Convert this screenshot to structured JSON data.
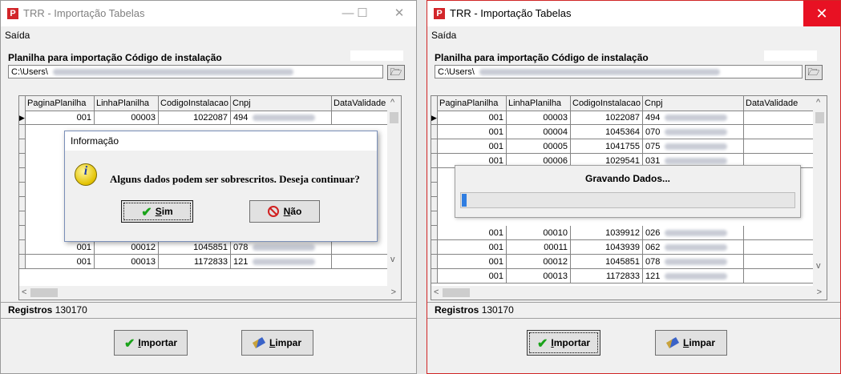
{
  "window_left": {
    "title": "TRR - Importação Tabelas",
    "controls": {
      "minimize": "—",
      "maximize": "☐",
      "close": "✕"
    },
    "menu": "Saída",
    "planilha_label": "Planilha para importação Código de instalação",
    "path": "C:\\Users\\",
    "grid": {
      "columns": [
        "PaginaPlanilha",
        "LinhaPlanilha",
        "CodigoInstalacao",
        "Cnpj",
        "DataValidade"
      ],
      "rows": [
        {
          "pagina": "001",
          "linha": "00003",
          "codigo": "1022087",
          "cnpj": "494"
        },
        {
          "pagina": "001",
          "linha": "00012",
          "codigo": "1045851",
          "cnpj": "078"
        },
        {
          "pagina": "001",
          "linha": "00013",
          "codigo": "1172833",
          "cnpj": "121"
        }
      ]
    },
    "registros_label": "Registros",
    "registros_value": "130170",
    "btn_importar": {
      "underlined": "I",
      "rest": "mportar"
    },
    "btn_limpar": {
      "underlined": "L",
      "rest": "impar"
    },
    "dialog": {
      "title": "Informação",
      "icon": "info-icon",
      "message": "Alguns dados podem ser sobrescritos. Deseja continuar?",
      "btn_sim": {
        "underlined": "S",
        "rest": "im"
      },
      "btn_nao": {
        "underlined": "N",
        "rest": "ão"
      }
    }
  },
  "window_right": {
    "title": "TRR - Importação Tabelas",
    "controls": {
      "close": "✕"
    },
    "menu": "Saída",
    "planilha_label": "Planilha para importação Código de instalação",
    "path": "C:\\Users\\",
    "grid": {
      "columns": [
        "PaginaPlanilha",
        "LinhaPlanilha",
        "CodigoInstalacao",
        "Cnpj",
        "DataValidade"
      ],
      "rows": [
        {
          "pagina": "001",
          "linha": "00003",
          "codigo": "1022087",
          "cnpj": "494"
        },
        {
          "pagina": "001",
          "linha": "00004",
          "codigo": "1045364",
          "cnpj": "070"
        },
        {
          "pagina": "001",
          "linha": "00005",
          "codigo": "1041755",
          "cnpj": "075"
        },
        {
          "pagina": "001",
          "linha": "00006",
          "codigo": "1029541",
          "cnpj": "031"
        },
        {
          "pagina": "001",
          "linha": "00010",
          "codigo": "1039912",
          "cnpj": "026"
        },
        {
          "pagina": "001",
          "linha": "00011",
          "codigo": "1043939",
          "cnpj": "062"
        },
        {
          "pagina": "001",
          "linha": "00012",
          "codigo": "1045851",
          "cnpj": "078"
        },
        {
          "pagina": "001",
          "linha": "00013",
          "codigo": "1172833",
          "cnpj": "121"
        }
      ]
    },
    "registros_label": "Registros",
    "registros_value": "130170",
    "btn_importar": {
      "underlined": "I",
      "rest": "mportar"
    },
    "btn_limpar": {
      "underlined": "L",
      "rest": "impar"
    },
    "progress": {
      "title": "Gravando Dados...",
      "fraction": 0.015
    }
  },
  "colors": {
    "progress": "#2f7de1",
    "close_hover": "#e81123",
    "app_icon": "#d2262a"
  }
}
